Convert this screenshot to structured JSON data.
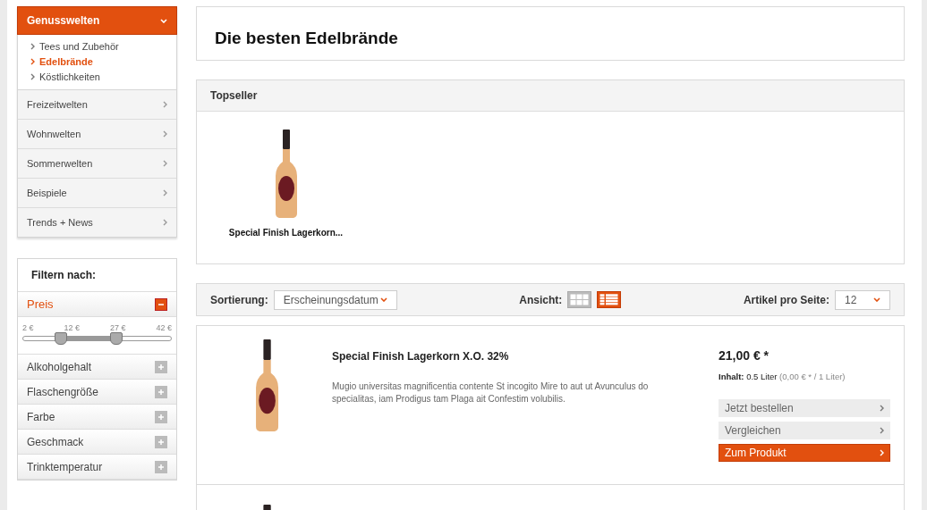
{
  "category_menu": {
    "title": "Genusswelten",
    "expanded": true,
    "subitems": [
      {
        "label": "Tees und Zubehör",
        "selected": false
      },
      {
        "label": "Edelbrände",
        "selected": true
      },
      {
        "label": "Köstlichkeiten",
        "selected": false
      }
    ],
    "items": [
      "Freizeitwelten",
      "Wohnwelten",
      "Sommerwelten",
      "Beispiele",
      "Trends + News"
    ]
  },
  "filter": {
    "title": "Filtern nach:",
    "groups": [
      {
        "label": "Preis",
        "expanded": true,
        "scale": [
          "2 €",
          "12 €",
          "27 €",
          "42 €"
        ],
        "handles": [
          {
            "level": 0.25
          },
          {
            "level": 0.625
          }
        ]
      },
      {
        "label": "Alkoholgehalt",
        "expanded": false
      },
      {
        "label": "Flaschengröße",
        "expanded": false
      },
      {
        "label": "Farbe",
        "expanded": false
      },
      {
        "label": "Geschmack",
        "expanded": false
      },
      {
        "label": "Trinktemperatur",
        "expanded": false
      }
    ]
  },
  "page_title": "Die besten Edelbrände",
  "topseller": {
    "title": "Topseller",
    "products": [
      {
        "name": "Special Finish Lagerkorn..."
      }
    ]
  },
  "toolbar": {
    "sort_label": "Sortierung:",
    "sort_value": "Erscheinungsdatum",
    "view_label": "Ansicht:",
    "views": [
      {
        "kind": "grid",
        "selected": false
      },
      {
        "kind": "list",
        "selected": true
      }
    ],
    "per_page_label": "Artikel pro Seite:",
    "per_page_value": "12"
  },
  "products": [
    {
      "name": "Special Finish Lagerkorn X.O. 32%",
      "description": "Mugio universitas magnificentia contente St incogito Mire to aut ut Avunculus do specialitas, iam Prodigus tam Plaga ait Confestim volubilis.",
      "price": "21,00 € *",
      "content_label": "Inhalt:",
      "content_value": "0.5 Liter",
      "unit_price": "(0,00 € * / 1 Liter)",
      "actions": [
        {
          "label": "Jetzt bestellen",
          "primary": false
        },
        {
          "label": "Vergleichen",
          "primary": false
        },
        {
          "label": "Zum Produkt",
          "primary": true
        }
      ]
    }
  ]
}
